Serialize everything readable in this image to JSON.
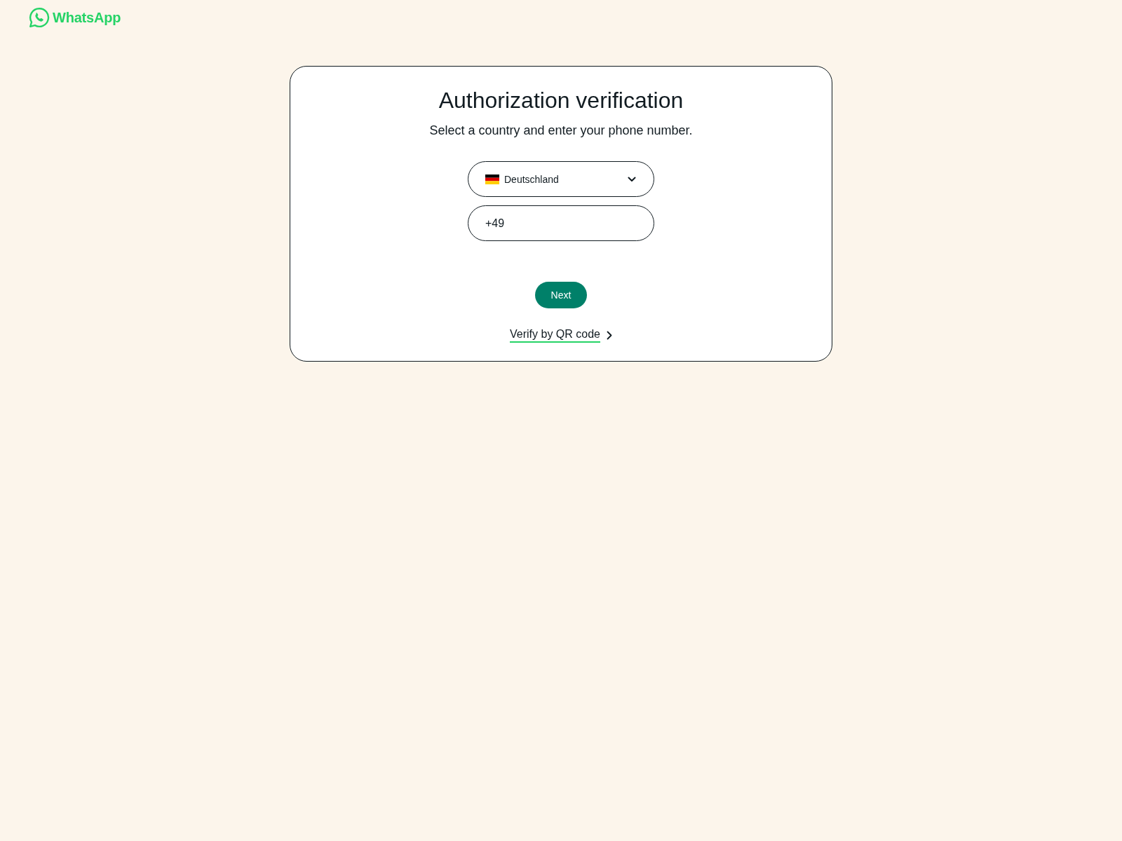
{
  "header": {
    "logo_text": "WhatsApp"
  },
  "card": {
    "title": "Authorization verification",
    "subtitle": "Select a country and enter your phone number.",
    "country_select": {
      "value": "Deutschland"
    },
    "phone_field": {
      "value": "+49"
    },
    "next_button": {
      "label": "Next"
    },
    "qr_link": {
      "label": "Verify by QR code"
    }
  }
}
